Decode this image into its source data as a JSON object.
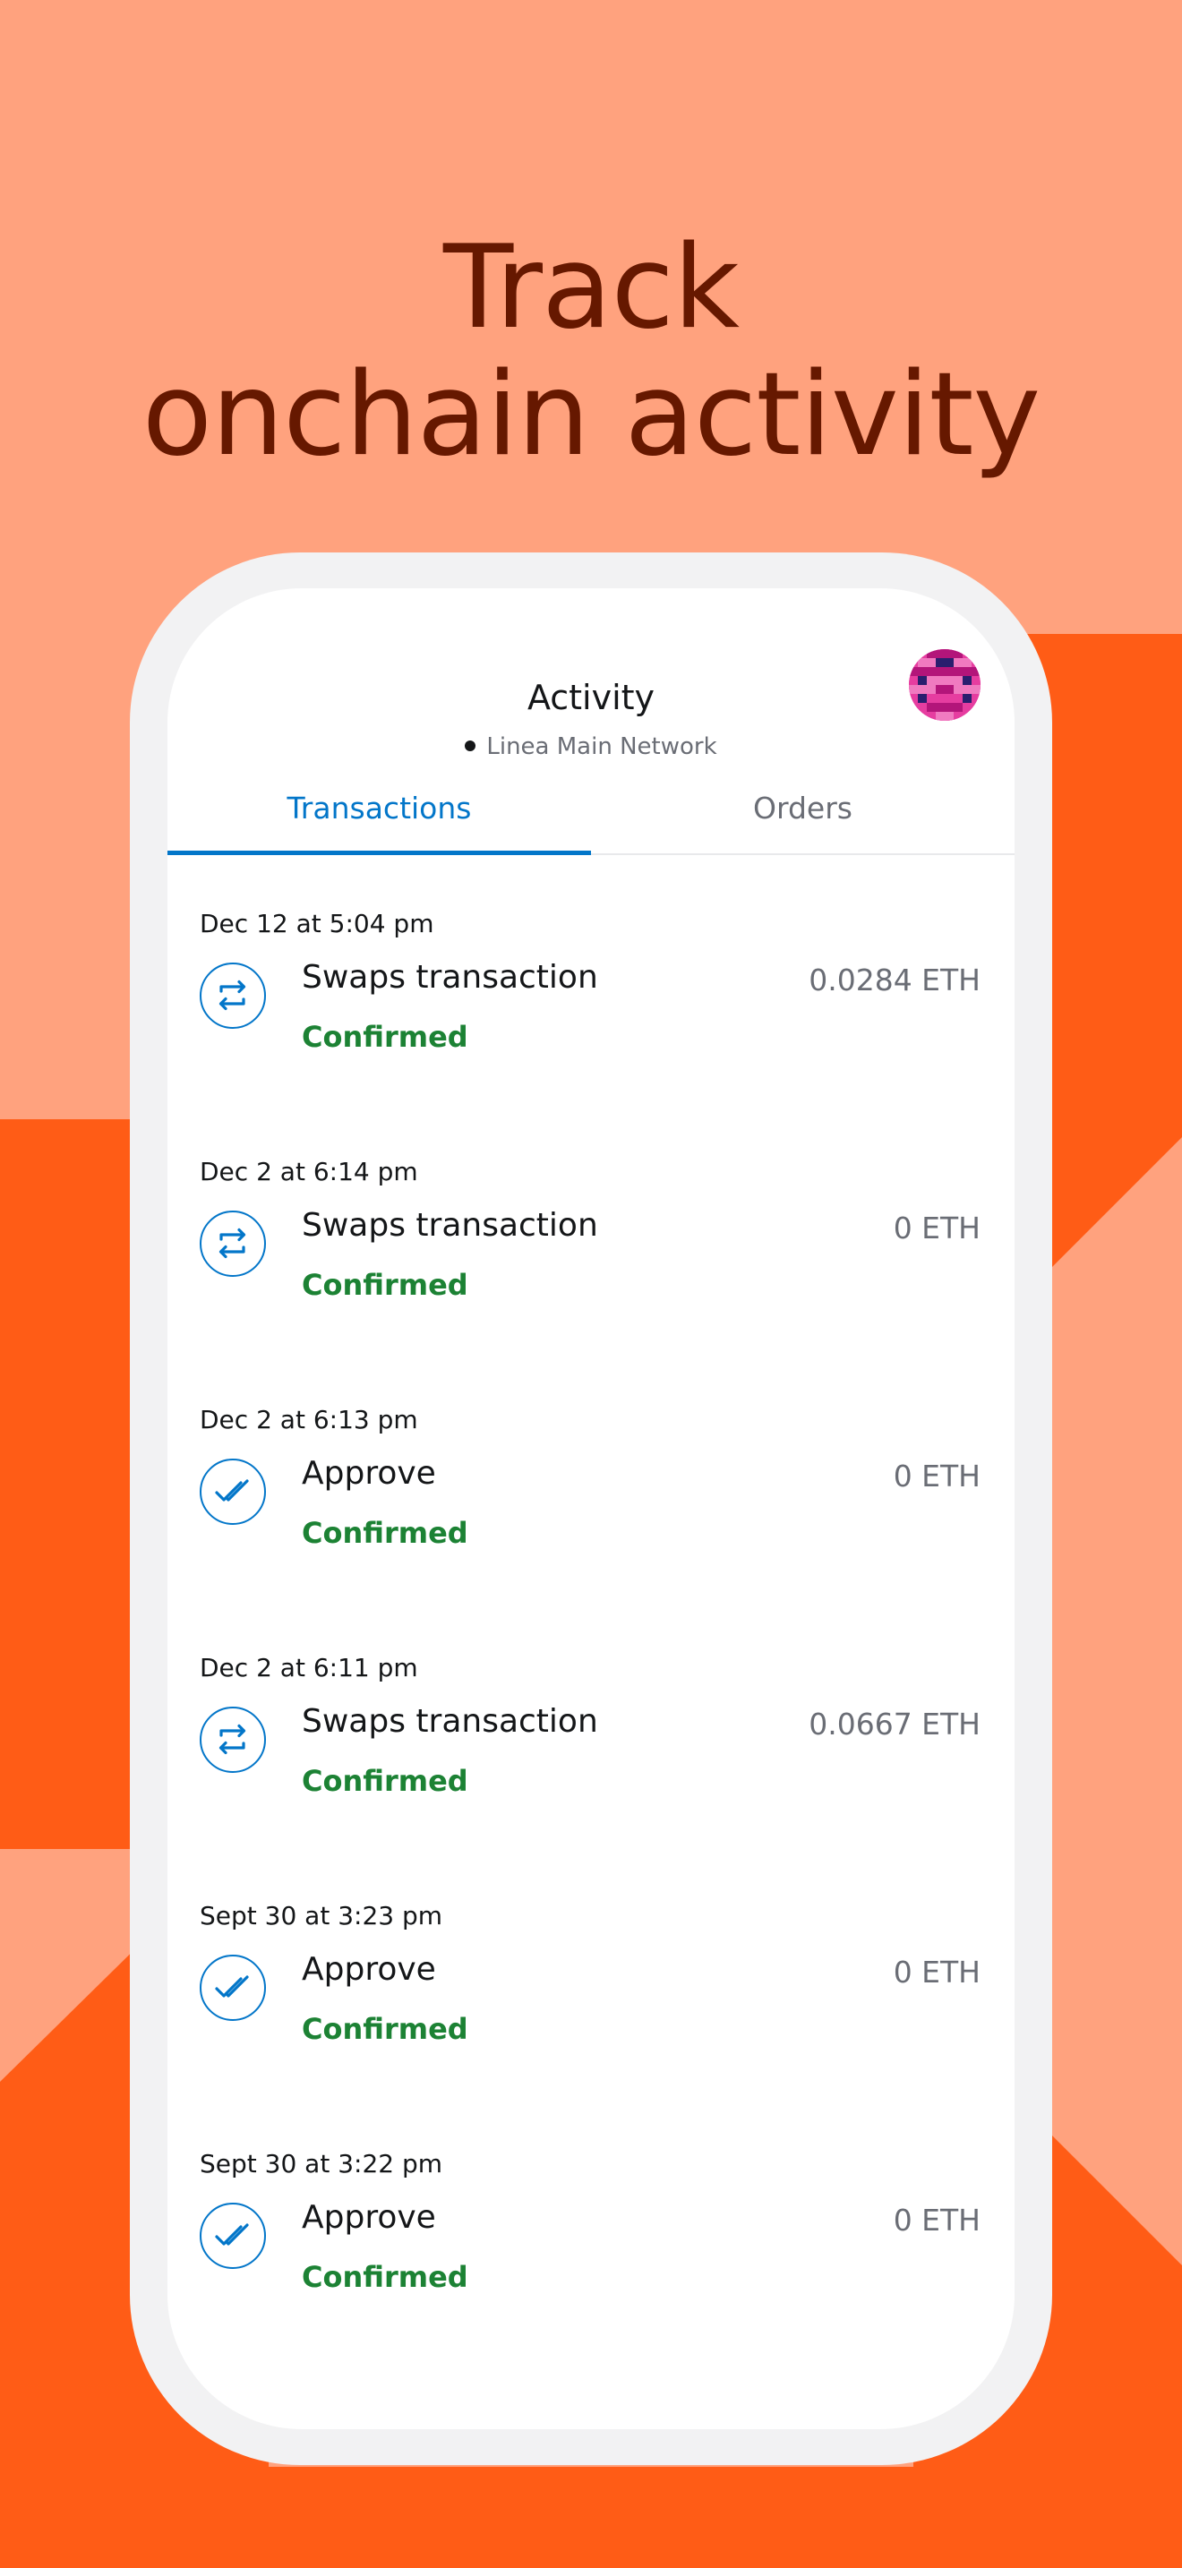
{
  "headline": {
    "line1": "Track",
    "line2": "onchain activity"
  },
  "colors": {
    "background_light": "#ffa27e",
    "background_dark": "#ff5c16",
    "headline": "#661800",
    "accent_blue": "#0376c9",
    "confirmed_green": "#1c8234"
  },
  "header": {
    "title": "Activity",
    "network": "Linea Main Network",
    "avatar_icon": "account-avatar-icon"
  },
  "tabs": [
    {
      "label": "Transactions",
      "active": true
    },
    {
      "label": "Orders",
      "active": false
    }
  ],
  "transactions": [
    {
      "date": "Dec 12 at 5:04 pm",
      "title": "Swaps transaction",
      "status": "Confirmed",
      "amount": "0.0284 ETH",
      "icon": "swap-icon"
    },
    {
      "date": "Dec 2 at 6:14 pm",
      "title": "Swaps transaction",
      "status": "Confirmed",
      "amount": "0 ETH",
      "icon": "swap-icon"
    },
    {
      "date": "Dec 2 at 6:13 pm",
      "title": "Approve",
      "status": "Confirmed",
      "amount": "0 ETH",
      "icon": "approve-check-icon"
    },
    {
      "date": "Dec 2 at 6:11 pm",
      "title": "Swaps transaction",
      "status": "Confirmed",
      "amount": "0.0667 ETH",
      "icon": "swap-icon"
    },
    {
      "date": "Sept 30 at 3:23 pm",
      "title": "Approve",
      "status": "Confirmed",
      "amount": "0 ETH",
      "icon": "approve-check-icon"
    },
    {
      "date": "Sept 30 at 3:22 pm",
      "title": "Approve",
      "status": "Confirmed",
      "amount": "0 ETH",
      "icon": "approve-check-icon"
    }
  ]
}
